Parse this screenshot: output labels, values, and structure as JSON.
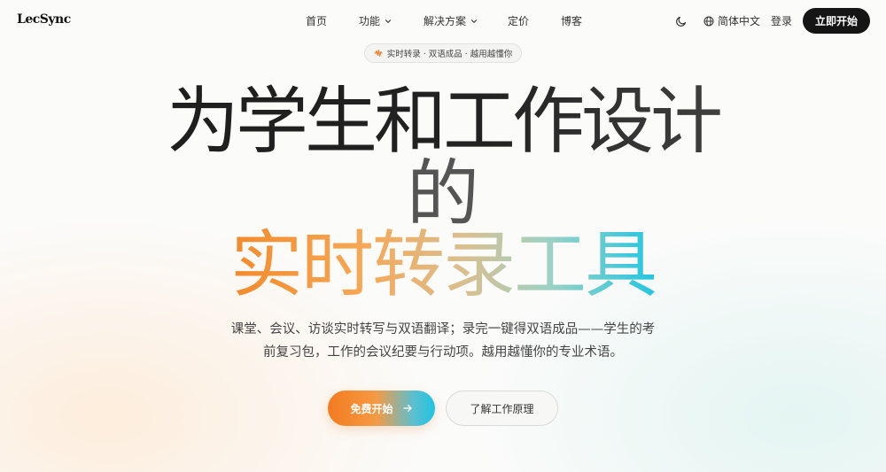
{
  "brand": {
    "logo_text": "LecSync"
  },
  "nav": {
    "links": [
      {
        "label": "首页"
      },
      {
        "label": "功能"
      },
      {
        "label": "解决方案"
      },
      {
        "label": "定价"
      },
      {
        "label": "博客"
      }
    ],
    "language": "简体中文",
    "login": "登录",
    "cta": "立即开始"
  },
  "badge": {
    "text": "实时转录 · 双语成品 · 越用越懂你"
  },
  "hero": {
    "line1": "为学生和工作设计",
    "line2": "的",
    "line3": "实时转录工具",
    "subtitle_line1": "课堂、会议、访谈实时转写与双语翻译；录完一键得双语成品——学生的考",
    "subtitle_line2": "前复习包，工作的会议纪要与行动项。越用越懂你的专业术语。"
  },
  "buttons": {
    "primary": "免费开始",
    "secondary": "了解工作原理"
  },
  "colors": {
    "accent_orange": "#f47b20",
    "accent_cyan": "#20c4e4",
    "dark_button": "#151515"
  },
  "icons": [
    "chevron-down-icon",
    "moon-icon",
    "globe-icon",
    "waveform-icon",
    "arrow-right-icon"
  ]
}
